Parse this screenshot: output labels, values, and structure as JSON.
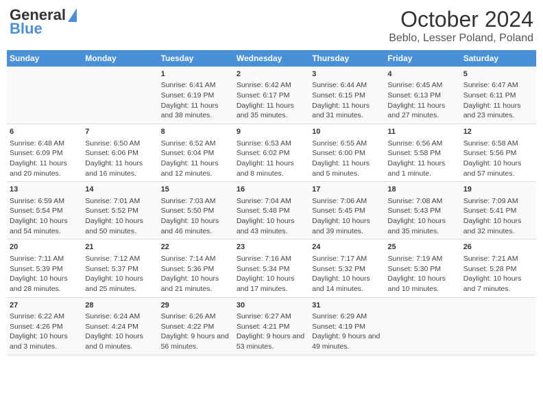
{
  "logo": {
    "line1": "General",
    "line2": "Blue"
  },
  "title": "October 2024",
  "subtitle": "Beblo, Lesser Poland, Poland",
  "days_of_week": [
    "Sunday",
    "Monday",
    "Tuesday",
    "Wednesday",
    "Thursday",
    "Friday",
    "Saturday"
  ],
  "weeks": [
    [
      {
        "day": "",
        "content": ""
      },
      {
        "day": "",
        "content": ""
      },
      {
        "day": "1",
        "content": "Sunrise: 6:41 AM\nSunset: 6:19 PM\nDaylight: 11 hours and 38 minutes."
      },
      {
        "day": "2",
        "content": "Sunrise: 6:42 AM\nSunset: 6:17 PM\nDaylight: 11 hours and 35 minutes."
      },
      {
        "day": "3",
        "content": "Sunrise: 6:44 AM\nSunset: 6:15 PM\nDaylight: 11 hours and 31 minutes."
      },
      {
        "day": "4",
        "content": "Sunrise: 6:45 AM\nSunset: 6:13 PM\nDaylight: 11 hours and 27 minutes."
      },
      {
        "day": "5",
        "content": "Sunrise: 6:47 AM\nSunset: 6:11 PM\nDaylight: 11 hours and 23 minutes."
      }
    ],
    [
      {
        "day": "6",
        "content": "Sunrise: 6:48 AM\nSunset: 6:09 PM\nDaylight: 11 hours and 20 minutes."
      },
      {
        "day": "7",
        "content": "Sunrise: 6:50 AM\nSunset: 6:06 PM\nDaylight: 11 hours and 16 minutes."
      },
      {
        "day": "8",
        "content": "Sunrise: 6:52 AM\nSunset: 6:04 PM\nDaylight: 11 hours and 12 minutes."
      },
      {
        "day": "9",
        "content": "Sunrise: 6:53 AM\nSunset: 6:02 PM\nDaylight: 11 hours and 8 minutes."
      },
      {
        "day": "10",
        "content": "Sunrise: 6:55 AM\nSunset: 6:00 PM\nDaylight: 11 hours and 5 minutes."
      },
      {
        "day": "11",
        "content": "Sunrise: 6:56 AM\nSunset: 5:58 PM\nDaylight: 11 hours and 1 minute."
      },
      {
        "day": "12",
        "content": "Sunrise: 6:58 AM\nSunset: 5:56 PM\nDaylight: 10 hours and 57 minutes."
      }
    ],
    [
      {
        "day": "13",
        "content": "Sunrise: 6:59 AM\nSunset: 5:54 PM\nDaylight: 10 hours and 54 minutes."
      },
      {
        "day": "14",
        "content": "Sunrise: 7:01 AM\nSunset: 5:52 PM\nDaylight: 10 hours and 50 minutes."
      },
      {
        "day": "15",
        "content": "Sunrise: 7:03 AM\nSunset: 5:50 PM\nDaylight: 10 hours and 46 minutes."
      },
      {
        "day": "16",
        "content": "Sunrise: 7:04 AM\nSunset: 5:48 PM\nDaylight: 10 hours and 43 minutes."
      },
      {
        "day": "17",
        "content": "Sunrise: 7:06 AM\nSunset: 5:45 PM\nDaylight: 10 hours and 39 minutes."
      },
      {
        "day": "18",
        "content": "Sunrise: 7:08 AM\nSunset: 5:43 PM\nDaylight: 10 hours and 35 minutes."
      },
      {
        "day": "19",
        "content": "Sunrise: 7:09 AM\nSunset: 5:41 PM\nDaylight: 10 hours and 32 minutes."
      }
    ],
    [
      {
        "day": "20",
        "content": "Sunrise: 7:11 AM\nSunset: 5:39 PM\nDaylight: 10 hours and 28 minutes."
      },
      {
        "day": "21",
        "content": "Sunrise: 7:12 AM\nSunset: 5:37 PM\nDaylight: 10 hours and 25 minutes."
      },
      {
        "day": "22",
        "content": "Sunrise: 7:14 AM\nSunset: 5:36 PM\nDaylight: 10 hours and 21 minutes."
      },
      {
        "day": "23",
        "content": "Sunrise: 7:16 AM\nSunset: 5:34 PM\nDaylight: 10 hours and 17 minutes."
      },
      {
        "day": "24",
        "content": "Sunrise: 7:17 AM\nSunset: 5:32 PM\nDaylight: 10 hours and 14 minutes."
      },
      {
        "day": "25",
        "content": "Sunrise: 7:19 AM\nSunset: 5:30 PM\nDaylight: 10 hours and 10 minutes."
      },
      {
        "day": "26",
        "content": "Sunrise: 7:21 AM\nSunset: 5:28 PM\nDaylight: 10 hours and 7 minutes."
      }
    ],
    [
      {
        "day": "27",
        "content": "Sunrise: 6:22 AM\nSunset: 4:26 PM\nDaylight: 10 hours and 3 minutes."
      },
      {
        "day": "28",
        "content": "Sunrise: 6:24 AM\nSunset: 4:24 PM\nDaylight: 10 hours and 0 minutes."
      },
      {
        "day": "29",
        "content": "Sunrise: 6:26 AM\nSunset: 4:22 PM\nDaylight: 9 hours and 56 minutes."
      },
      {
        "day": "30",
        "content": "Sunrise: 6:27 AM\nSunset: 4:21 PM\nDaylight: 9 hours and 53 minutes."
      },
      {
        "day": "31",
        "content": "Sunrise: 6:29 AM\nSunset: 4:19 PM\nDaylight: 9 hours and 49 minutes."
      },
      {
        "day": "",
        "content": ""
      },
      {
        "day": "",
        "content": ""
      }
    ]
  ]
}
